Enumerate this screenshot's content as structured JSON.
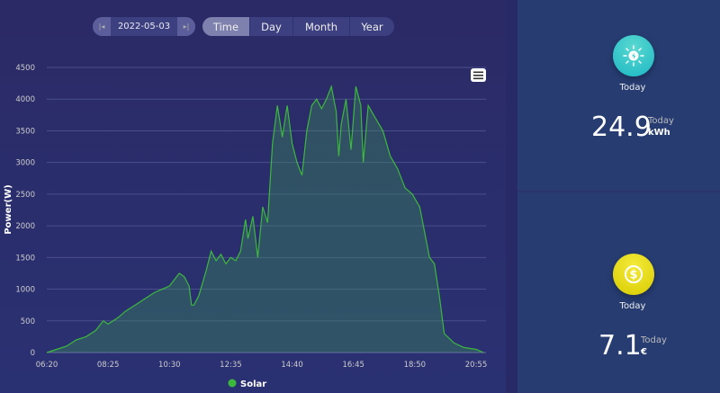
{
  "controls": {
    "date": "2022-05-03",
    "prev_icon": "skip-back-icon",
    "next_icon": "skip-forward-icon",
    "tabs": [
      "Time",
      "Day",
      "Month",
      "Year"
    ],
    "active_tab": "Time"
  },
  "chart_data": {
    "type": "area",
    "ylabel": "Power(W)",
    "ylim": [
      0,
      4500
    ],
    "yticks": [
      0,
      500,
      1000,
      1500,
      2000,
      2500,
      3000,
      3500,
      4000,
      4500
    ],
    "xticks": [
      "06:20",
      "08:25",
      "10:30",
      "12:35",
      "14:40",
      "16:45",
      "18:50",
      "20:55"
    ],
    "legend": "bottom",
    "grid": true,
    "color": "#3cb93c",
    "series": [
      {
        "name": "Solar",
        "points": [
          [
            "06:20",
            0
          ],
          [
            "06:40",
            50
          ],
          [
            "07:00",
            100
          ],
          [
            "07:20",
            200
          ],
          [
            "07:40",
            250
          ],
          [
            "08:00",
            350
          ],
          [
            "08:15",
            500
          ],
          [
            "08:25",
            450
          ],
          [
            "08:45",
            550
          ],
          [
            "09:00",
            650
          ],
          [
            "09:20",
            750
          ],
          [
            "09:40",
            850
          ],
          [
            "10:00",
            950
          ],
          [
            "10:15",
            1000
          ],
          [
            "10:30",
            1050
          ],
          [
            "10:40",
            1150
          ],
          [
            "10:50",
            1250
          ],
          [
            "11:00",
            1200
          ],
          [
            "11:10",
            1050
          ],
          [
            "11:15",
            750
          ],
          [
            "11:20",
            750
          ],
          [
            "11:30",
            900
          ],
          [
            "11:45",
            1300
          ],
          [
            "11:55",
            1600
          ],
          [
            "12:05",
            1450
          ],
          [
            "12:15",
            1550
          ],
          [
            "12:25",
            1400
          ],
          [
            "12:35",
            1500
          ],
          [
            "12:45",
            1450
          ],
          [
            "12:55",
            1600
          ],
          [
            "13:05",
            2100
          ],
          [
            "13:10",
            1800
          ],
          [
            "13:20",
            2150
          ],
          [
            "13:30",
            1500
          ],
          [
            "13:40",
            2300
          ],
          [
            "13:50",
            2050
          ],
          [
            "14:00",
            3300
          ],
          [
            "14:10",
            3900
          ],
          [
            "14:20",
            3400
          ],
          [
            "14:30",
            3900
          ],
          [
            "14:40",
            3300
          ],
          [
            "14:50",
            3000
          ],
          [
            "15:00",
            2800
          ],
          [
            "15:10",
            3500
          ],
          [
            "15:20",
            3900
          ],
          [
            "15:30",
            4000
          ],
          [
            "15:40",
            3850
          ],
          [
            "15:50",
            4000
          ],
          [
            "16:00",
            4200
          ],
          [
            "16:10",
            3800
          ],
          [
            "16:15",
            3100
          ],
          [
            "16:20",
            3600
          ],
          [
            "16:30",
            4000
          ],
          [
            "16:40",
            3200
          ],
          [
            "16:50",
            4200
          ],
          [
            "17:00",
            3900
          ],
          [
            "17:05",
            3000
          ],
          [
            "17:15",
            3900
          ],
          [
            "17:30",
            3700
          ],
          [
            "17:45",
            3500
          ],
          [
            "18:00",
            3100
          ],
          [
            "18:15",
            2900
          ],
          [
            "18:30",
            2600
          ],
          [
            "18:45",
            2500
          ],
          [
            "19:00",
            2300
          ],
          [
            "19:10",
            1900
          ],
          [
            "19:20",
            1500
          ],
          [
            "19:30",
            1400
          ],
          [
            "19:40",
            900
          ],
          [
            "19:50",
            300
          ],
          [
            "20:10",
            150
          ],
          [
            "20:30",
            80
          ],
          [
            "20:55",
            50
          ],
          [
            "21:10",
            0
          ]
        ]
      }
    ]
  },
  "menu_icon": "hamburger-menu-icon",
  "production": {
    "icon": "sun-bolt-icon",
    "label": "Today",
    "value": "24.9",
    "period": "Today",
    "unit": "kWh",
    "color": "#2cc4c4"
  },
  "revenue": {
    "icon": "dollar-coin-icon",
    "label": "Today",
    "value": "7.1",
    "period": "Today",
    "unit": "€",
    "color": "#e6dc10"
  }
}
